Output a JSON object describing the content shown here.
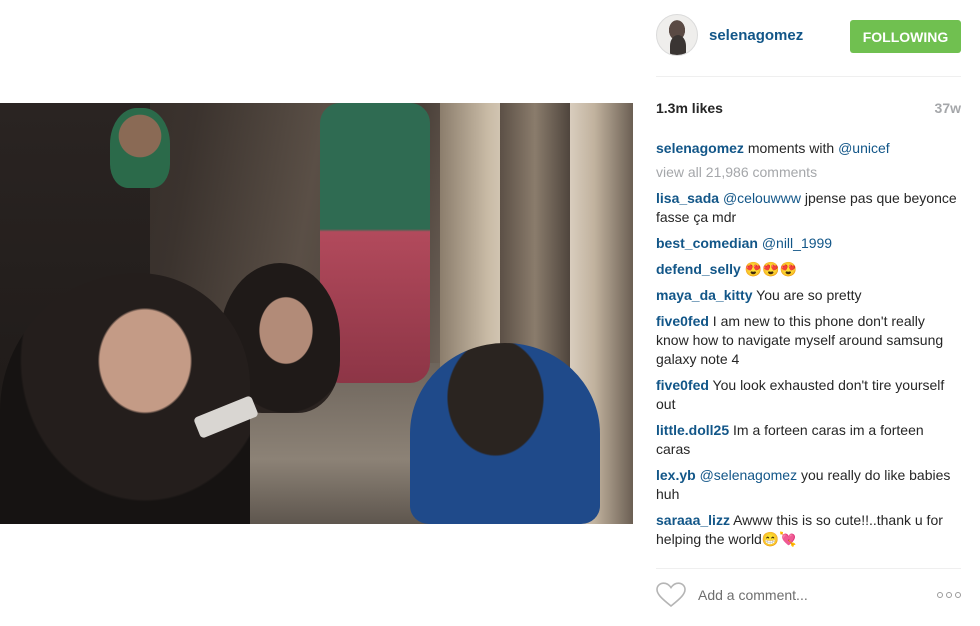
{
  "post": {
    "username": "selenagomez",
    "follow_label": "FOLLOWING",
    "likes": "1.3m likes",
    "time_ago": "37w",
    "caption": {
      "user": "selenagomez",
      "text": " moments with ",
      "mention": "@unicef"
    },
    "view_all": "view all 21,986 comments"
  },
  "comments": [
    {
      "user": "lisa_sada",
      "mention": "@celouwww",
      "text": " jpense pas que beyonce fasse ça mdr"
    },
    {
      "user": "best_comedian",
      "mention": "@nill_1999",
      "text": ""
    },
    {
      "user": "defend_selly",
      "mention": "",
      "text": " 😍😍😍"
    },
    {
      "user": "maya_da_kitty",
      "mention": "",
      "text": " You are so pretty"
    },
    {
      "user": "five0fed",
      "mention": "",
      "text": " I am new to this phone don't really know how to navigate myself around samsung galaxy note 4"
    },
    {
      "user": "five0fed",
      "mention": "",
      "text": " You look exhausted don't tire yourself out"
    },
    {
      "user": "little.doll25",
      "mention": "",
      "text": " Im a forteen caras im a forteen caras"
    },
    {
      "user": "lex.yb",
      "mention": "@selenagomez",
      "text": " you really do like babies huh"
    },
    {
      "user": "saraaa_lizz",
      "mention": "",
      "text": " Awww this is so cute!!..thank u for helping the world😁💘"
    }
  ],
  "comment_box": {
    "placeholder": "Add a comment..."
  },
  "icons": {
    "like": "heart-icon",
    "more": "more-options-icon"
  },
  "colors": {
    "link": "#125688",
    "follow": "#70c050",
    "muted": "#a5a7aa"
  }
}
